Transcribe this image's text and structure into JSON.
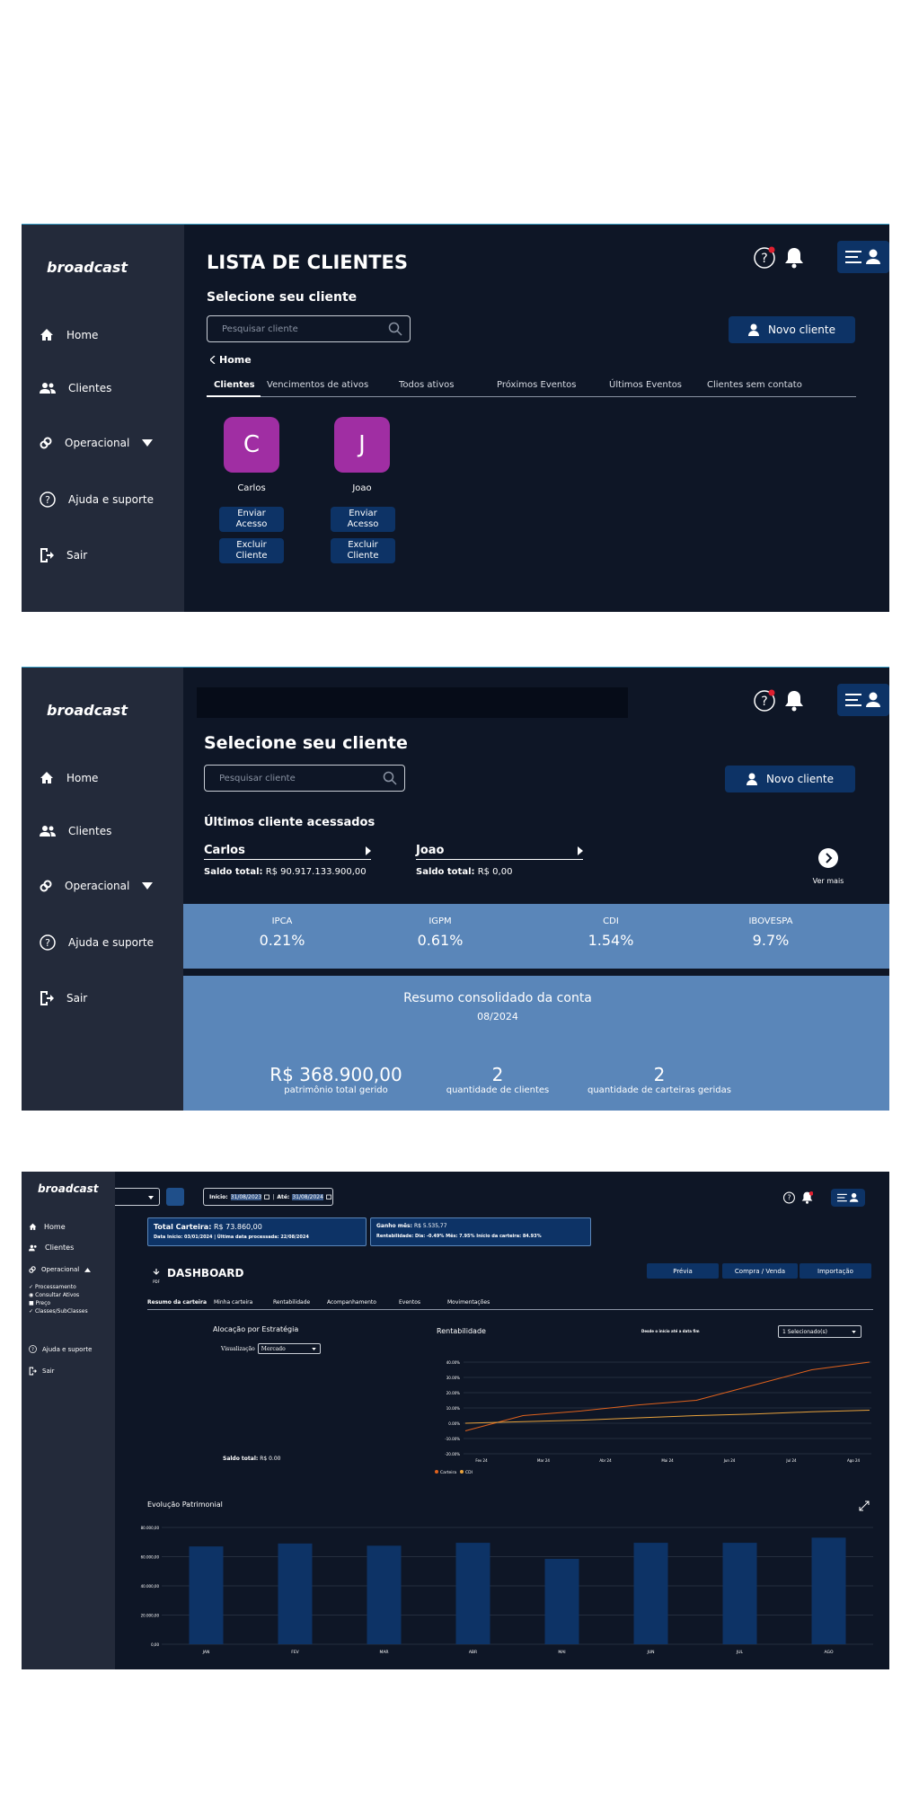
{
  "app": {
    "logo": "broadcast"
  },
  "nav": {
    "home": "Home",
    "clientes": "Clientes",
    "operacional": "Operacional",
    "ajuda": "Ajuda e suporte",
    "sair": "Sair"
  },
  "screen1": {
    "title": "LISTA DE CLIENTES",
    "subtitle": "Selecione seu cliente",
    "search_placeholder": "Pesquisar cliente",
    "novo_cliente": "Novo cliente",
    "back": "Home",
    "tabs": [
      "Clientes",
      "Vencimentos de ativos",
      "Todos ativos",
      "Próximos Eventos",
      "Últimos Eventos",
      "Clientes sem contato"
    ],
    "clients": [
      {
        "initial": "C",
        "name": "Carlos",
        "enviar": "Enviar Acesso",
        "excluir": "Excluir Cliente"
      },
      {
        "initial": "J",
        "name": "Joao",
        "enviar": "Enviar Acesso",
        "excluir": "Excluir Cliente"
      }
    ]
  },
  "screen2": {
    "subtitle": "Selecione seu cliente",
    "search_placeholder": "Pesquisar cliente",
    "novo_cliente": "Novo cliente",
    "recent_title": "Últimos cliente acessados",
    "recent": [
      {
        "name": "Carlos",
        "saldo_label": "Saldo total:",
        "saldo": "R$ 90.917.133.900,00"
      },
      {
        "name": "Joao",
        "saldo_label": "Saldo total:",
        "saldo": "R$ 0,00"
      }
    ],
    "ver_mais": "Ver mais",
    "indices": [
      {
        "label": "IPCA",
        "value": "0.21%"
      },
      {
        "label": "IGPM",
        "value": "0.61%"
      },
      {
        "label": "CDI",
        "value": "1.54%"
      },
      {
        "label": "IBOVESPA",
        "value": "9.7%"
      }
    ],
    "resumo_title": "Resumo consolidado da conta",
    "resumo_date": "08/2024",
    "stats": [
      {
        "value": "R$ 368.900,00",
        "label": "patrimônio total gerido"
      },
      {
        "value": "2",
        "label": "quantidade de clientes"
      },
      {
        "value": "2",
        "label": "quantidade de carteiras geridas"
      }
    ]
  },
  "screen3": {
    "sub_nav": [
      "Processamento",
      "Consultar Ativos",
      "Preço",
      "Classes/SubClasses"
    ],
    "date_inicio_label": "Início:",
    "date_inicio": "31/08/2023",
    "date_ate_label": "Até:",
    "date_ate": "31/08/2024",
    "card1_title_label": "Total Carteira:",
    "card1_title_value": "R$ 73.860,00",
    "card1_line": "Data Início: 03/01/2024 | Última data processada: 22/08/2024",
    "card2_l1_label": "Ganho mês:",
    "card2_l1_value": "R$ 5.535,77",
    "card2_l2": "Rentabilidade: Dia: -0.49%  Mês: 7.95%  Início da carteira: 84.93%",
    "dashboard": "DASHBOARD",
    "pdf": "PDF",
    "actions": [
      "Prévia",
      "Compra / Venda",
      "Importação"
    ],
    "tabs": [
      "Resumo da carteira",
      "Minha carteira",
      "Rentabilidade",
      "Acompanhamento",
      "Eventos",
      "Movimentações"
    ],
    "alocacao_title": "Alocação por Estratégia",
    "visualizacao_label": "Visualização",
    "visualizacao_value": "Mercado",
    "saldo_label": "Saldo total:",
    "saldo_value": "R$ 0.00",
    "rent_title": "Rentabilidade",
    "rent_range": "Desde o início até a data fim",
    "rent_select": "1 Selecionado(s)",
    "evolucao_title": "Evolução Patrimonial"
  },
  "chart_data": [
    {
      "type": "line",
      "title": "Rentabilidade",
      "x": [
        "Fev 24",
        "Mar 24",
        "Abr 24",
        "Mai 24",
        "Jun 24",
        "Jul 24",
        "Ago 24"
      ],
      "series": [
        {
          "name": "Carteira",
          "color": "#e0621d",
          "values": [
            -5.0,
            5.0,
            8.0,
            12.0,
            15.0,
            25.0,
            35.0,
            40.0
          ]
        },
        {
          "name": "CDI",
          "color": "#e8a23c",
          "values": [
            0.0,
            1.0,
            2.0,
            3.5,
            5.0,
            6.0,
            7.5,
            8.5
          ]
        }
      ],
      "yticks": [
        "40.00%",
        "30.00%",
        "20.00%",
        "10.00%",
        "0.00%",
        "-10.00%",
        "-20.00%"
      ],
      "ylim": [
        -20,
        40
      ]
    },
    {
      "type": "bar",
      "title": "Evolução Patrimonial",
      "categories": [
        "JAN",
        "FEV",
        "MAR",
        "ABR",
        "MAI",
        "JUN",
        "JUL",
        "AGO"
      ],
      "values": [
        67000,
        69000,
        67500,
        69500,
        58500,
        69500,
        69500,
        73000
      ],
      "yticks": [
        "80.000,00",
        "60.000,00",
        "40.000,00",
        "20.000,00",
        "0,00"
      ],
      "ylim": [
        0,
        80000
      ],
      "color": "#0d3366"
    }
  ]
}
